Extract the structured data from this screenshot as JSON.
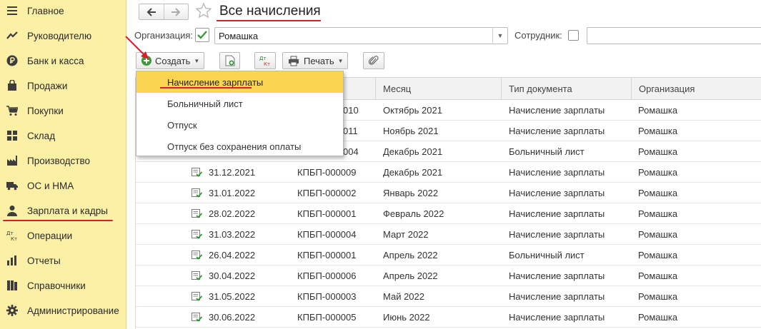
{
  "sidebar": {
    "items": [
      {
        "label": "Главное",
        "icon": "menu-icon"
      },
      {
        "label": "Руководителю",
        "icon": "trend-icon"
      },
      {
        "label": "Банк и касса",
        "icon": "ruble-icon"
      },
      {
        "label": "Продажи",
        "icon": "bag-icon"
      },
      {
        "label": "Покупки",
        "icon": "cart-icon"
      },
      {
        "label": "Склад",
        "icon": "warehouse-icon"
      },
      {
        "label": "Производство",
        "icon": "factory-icon"
      },
      {
        "label": "ОС и НМА",
        "icon": "truck-icon"
      },
      {
        "label": "Зарплата и кадры",
        "icon": "person-icon"
      },
      {
        "label": "Операции",
        "icon": "dt-kt-icon"
      },
      {
        "label": "Отчеты",
        "icon": "chart-icon"
      },
      {
        "label": "Справочники",
        "icon": "books-icon"
      },
      {
        "label": "Администрирование",
        "icon": "gear-icon"
      }
    ],
    "active_index": 8
  },
  "header": {
    "title": "Все начисления"
  },
  "filters": {
    "org_label": "Организация:",
    "org_checked": true,
    "org_value": "Ромашка",
    "employee_label": "Сотрудник:",
    "employee_checked": false,
    "employee_value": ""
  },
  "toolbar": {
    "create_label": "Создать",
    "print_label": "Печать"
  },
  "create_menu": {
    "items": [
      "Начисление зарплаты",
      "Больничный лист",
      "Отпуск",
      "Отпуск без сохранения оплаты"
    ],
    "highlighted_index": 0
  },
  "table": {
    "columns": [
      "Месяц",
      "Тип документа",
      "Организация"
    ],
    "rows": [
      {
        "date": "",
        "number": "010",
        "month": "Октябрь 2021",
        "doc_type": "Начисление зарплаты",
        "org": "Ромашка"
      },
      {
        "date": "",
        "number": "011",
        "month": "Ноябрь 2021",
        "doc_type": "Начисление зарплаты",
        "org": "Ромашка"
      },
      {
        "date": "",
        "number": "004",
        "month": "Декабрь 2021",
        "doc_type": "Больничный лист",
        "org": "Ромашка"
      },
      {
        "date": "31.12.2021",
        "number": "КПБП-000009",
        "month": "Декабрь 2021",
        "doc_type": "Начисление зарплаты",
        "org": "Ромашка"
      },
      {
        "date": "31.01.2022",
        "number": "КПБП-000002",
        "month": "Январь 2022",
        "doc_type": "Начисление зарплаты",
        "org": "Ромашка"
      },
      {
        "date": "28.02.2022",
        "number": "КПБП-000001",
        "month": "Февраль 2022",
        "doc_type": "Начисление зарплаты",
        "org": "Ромашка"
      },
      {
        "date": "31.03.2022",
        "number": "КПБП-000004",
        "month": "Март 2022",
        "doc_type": "Начисление зарплаты",
        "org": "Ромашка"
      },
      {
        "date": "26.04.2022",
        "number": "КПБП-000001",
        "month": "Апрель 2022",
        "doc_type": "Больничный лист",
        "org": "Ромашка"
      },
      {
        "date": "30.04.2022",
        "number": "КПБП-000006",
        "month": "Апрель 2022",
        "doc_type": "Начисление зарплаты",
        "org": "Ромашка"
      },
      {
        "date": "31.05.2022",
        "number": "КПБП-000003",
        "month": "Май 2022",
        "doc_type": "Начисление зарплаты",
        "org": "Ромашка"
      },
      {
        "date": "30.06.2022",
        "number": "КПБП-000005",
        "month": "Июнь 2022",
        "doc_type": "Начисление зарплаты",
        "org": "Ромашка"
      }
    ]
  },
  "colors": {
    "sidebar_bg": "#fbf0a6",
    "menu_highlight": "#fbd452",
    "annotation_red": "#d9202a",
    "checkbox_green": "#3a9a3a"
  }
}
